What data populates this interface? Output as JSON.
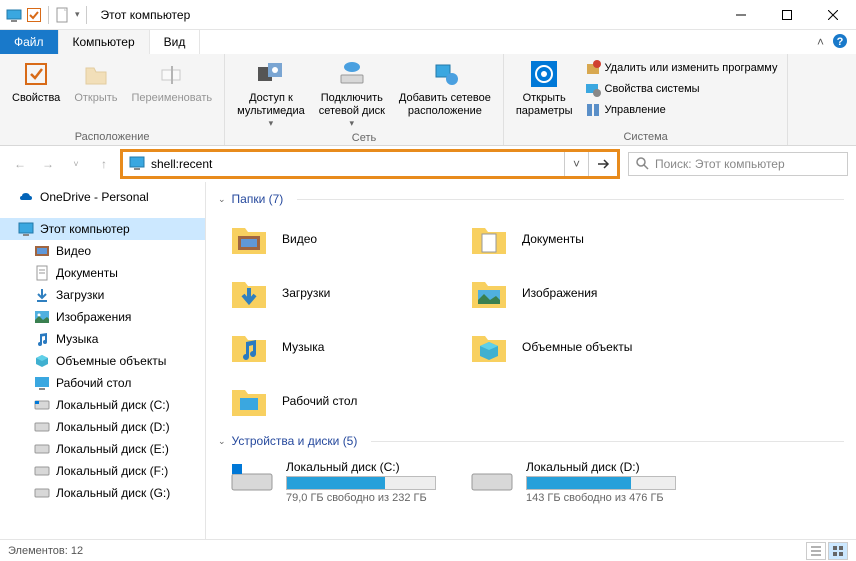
{
  "title": "Этот компьютер",
  "tabs": {
    "file": "Файл",
    "computer": "Компьютер",
    "view": "Вид"
  },
  "ribbon": {
    "group1": {
      "label": "Расположение",
      "properties": "Свойства",
      "open": "Открыть",
      "rename": "Переименовать"
    },
    "group2": {
      "label": "Сеть",
      "media": "Доступ к\nмультимедиа",
      "netdrive": "Подключить\nсетевой диск",
      "addnet": "Добавить сетевое\nрасположение"
    },
    "group3": {
      "label": "Система",
      "openparams": "Открыть\nпараметры",
      "uninstall": "Удалить или изменить программу",
      "sysprops": "Свойства системы",
      "manage": "Управление"
    }
  },
  "address": "shell:recent",
  "search_placeholder": "Поиск: Этот компьютер",
  "sidebar": {
    "onedrive": "OneDrive - Personal",
    "thispc": "Этот компьютер",
    "video": "Видео",
    "documents": "Документы",
    "downloads": "Загрузки",
    "pictures": "Изображения",
    "music": "Музыка",
    "objects3d": "Объемные объекты",
    "desktop": "Рабочий стол",
    "diskc": "Локальный диск (C:)",
    "diskd": "Локальный диск (D:)",
    "diske": "Локальный диск (E:)",
    "diskf": "Локальный диск (F:)",
    "diskg": "Локальный диск (G:)"
  },
  "sections": {
    "folders": "Папки (7)",
    "drives": "Устройства и диски (5)"
  },
  "folders": {
    "video": "Видео",
    "documents": "Документы",
    "downloads": "Загрузки",
    "pictures": "Изображения",
    "music": "Музыка",
    "objects3d": "Объемные объекты",
    "desktop": "Рабочий стол"
  },
  "drives": [
    {
      "name": "Локальный диск (C:)",
      "free": "79,0 ГБ свободно из 232 ГБ",
      "fill": 66
    },
    {
      "name": "Локальный диск (D:)",
      "free": "143 ГБ свободно из 476 ГБ",
      "fill": 70
    }
  ],
  "status": "Элементов: 12"
}
